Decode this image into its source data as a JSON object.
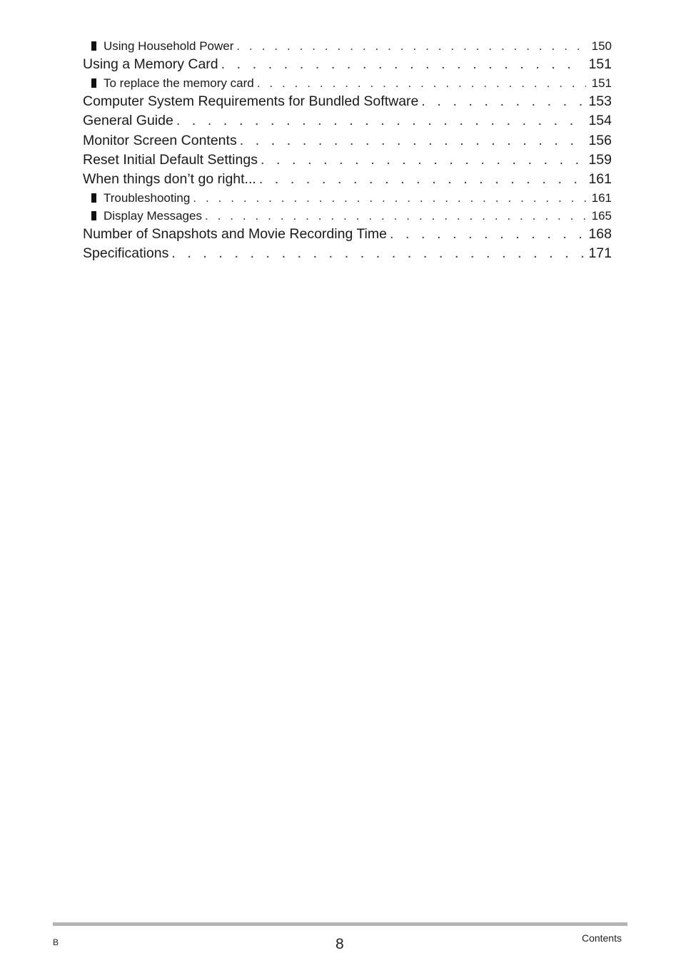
{
  "toc": {
    "entries": [
      {
        "level": "sub",
        "title": "Using Household Power",
        "page": "150"
      },
      {
        "level": "main",
        "title": "Using a Memory Card",
        "page": "151"
      },
      {
        "level": "sub",
        "title": "To replace the memory card",
        "page": "151"
      },
      {
        "level": "main",
        "title": "Computer System Requirements for Bundled Software",
        "page": "153"
      },
      {
        "level": "main",
        "title": "General Guide",
        "page": "154"
      },
      {
        "level": "main",
        "title": "Monitor Screen Contents",
        "page": "156"
      },
      {
        "level": "main",
        "title": "Reset Initial Default Settings",
        "page": "159"
      },
      {
        "level": "main",
        "title": "When things don’t go right...",
        "page": "161"
      },
      {
        "level": "sub",
        "title": "Troubleshooting",
        "page": "161"
      },
      {
        "level": "sub",
        "title": "Display Messages",
        "page": "165"
      },
      {
        "level": "main",
        "title": "Number of Snapshots and Movie Recording Time",
        "page": "168"
      },
      {
        "level": "main",
        "title": "Specifications",
        "page": "171"
      }
    ],
    "leader": ". . . . . . . . . . . . . . . . . . . . . . . . . . . . . . . . . . . . . . . . . . . . . . . . . . . . . . . . . . . . . . . . . . . . . . . . . . . . . . . . . . ."
  },
  "footer": {
    "left_label": "B",
    "page_number": "8",
    "section_label": "Contents"
  }
}
